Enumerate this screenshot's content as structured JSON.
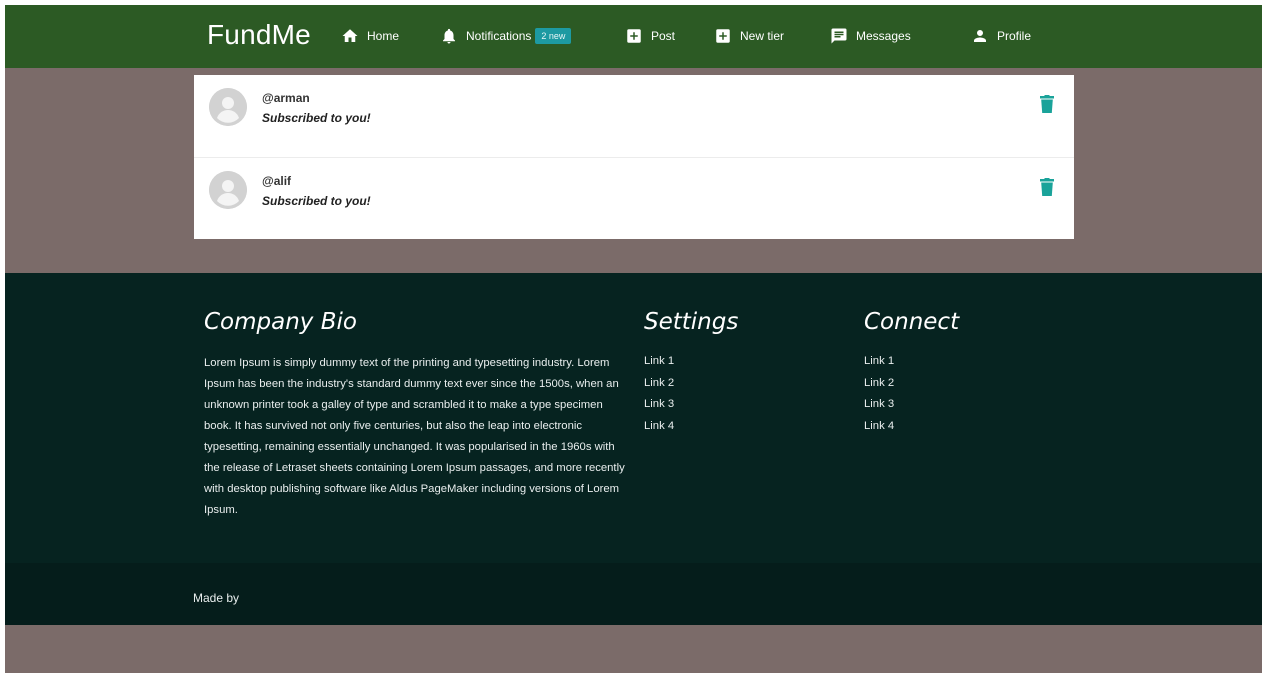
{
  "navbar": {
    "brand": "FundMe",
    "items": [
      {
        "label": "Home",
        "icon": "home-icon"
      },
      {
        "label": "Notifications",
        "icon": "bell-icon",
        "badge": "2 new"
      },
      {
        "label": "Post",
        "icon": "plus-square-icon"
      },
      {
        "label": "New tier",
        "icon": "plus-square-icon"
      },
      {
        "label": "Messages",
        "icon": "message-icon"
      },
      {
        "label": "Profile",
        "icon": "person-icon"
      }
    ]
  },
  "notifications": [
    {
      "username": "@arman",
      "message": "Subscribed to you!",
      "icon": "trash-icon"
    },
    {
      "username": "@alif",
      "message": "Subscribed to you!",
      "icon": "trash-icon"
    }
  ],
  "footer": {
    "bio_title": "Company Bio",
    "bio_text": "Lorem Ipsum is simply dummy text of the printing and typesetting industry. Lorem Ipsum has been the industry's standard dummy text ever since the 1500s, when an unknown printer took a galley of type and scrambled it to make a type specimen book. It has survived not only five centuries, but also the leap into electronic typesetting, remaining essentially unchanged. It was popularised in the 1960s with the release of Letraset sheets containing Lorem Ipsum passages, and more recently with desktop publishing software like Aldus PageMaker including versions of Lorem Ipsum.",
    "settings_title": "Settings",
    "settings_links": [
      "Link 1",
      "Link 2",
      "Link 3",
      "Link 4"
    ],
    "connect_title": "Connect",
    "connect_links": [
      "Link 1",
      "Link 2",
      "Link 3",
      "Link 4"
    ],
    "made_by": "Made by"
  },
  "colors": {
    "navbar": "#2c5a24",
    "page_background": "#7b6b69",
    "footer": "#062320",
    "badge": "#1d9aa2",
    "trash": "#1aa39a"
  }
}
